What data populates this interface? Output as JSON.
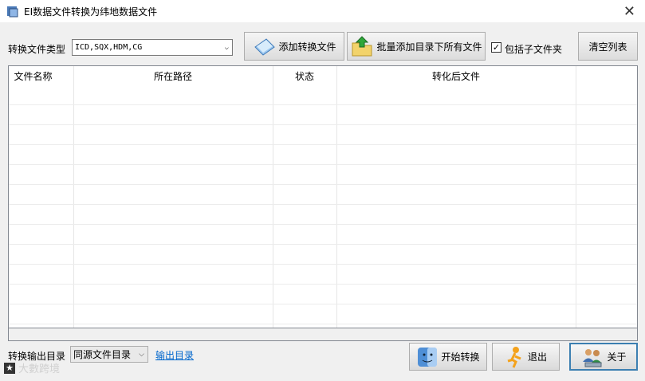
{
  "window": {
    "title": "EI数据文件转换为纬地数据文件",
    "close_glyph": "✕"
  },
  "toolbar": {
    "type_label": "转换文件类型",
    "type_value": "ICD,SQX,HDM,CG",
    "add_button": "添加转换文件",
    "batch_button": "批量添加目录下所有文件",
    "include_subfolders": "包括子文件夹",
    "include_subfolders_checked": true,
    "clear_button": "清空列表"
  },
  "table": {
    "columns": [
      "文件名称",
      "所在路径",
      "状态",
      "转化后文件"
    ],
    "rows": []
  },
  "footer": {
    "output_label": "转换输出目录",
    "output_select": "同源文件目录",
    "output_link": "输出目录",
    "start_button": "开始转换",
    "exit_button": "退出",
    "about_button": "关于"
  },
  "watermark": {
    "star": "★",
    "text": "大數跨境"
  },
  "icons": {
    "app": "app-icon",
    "add": "document-icon",
    "batch": "folder-arrow-icon",
    "start": "mac-finder-icon",
    "exit": "running-man-icon",
    "about": "users-icon"
  }
}
